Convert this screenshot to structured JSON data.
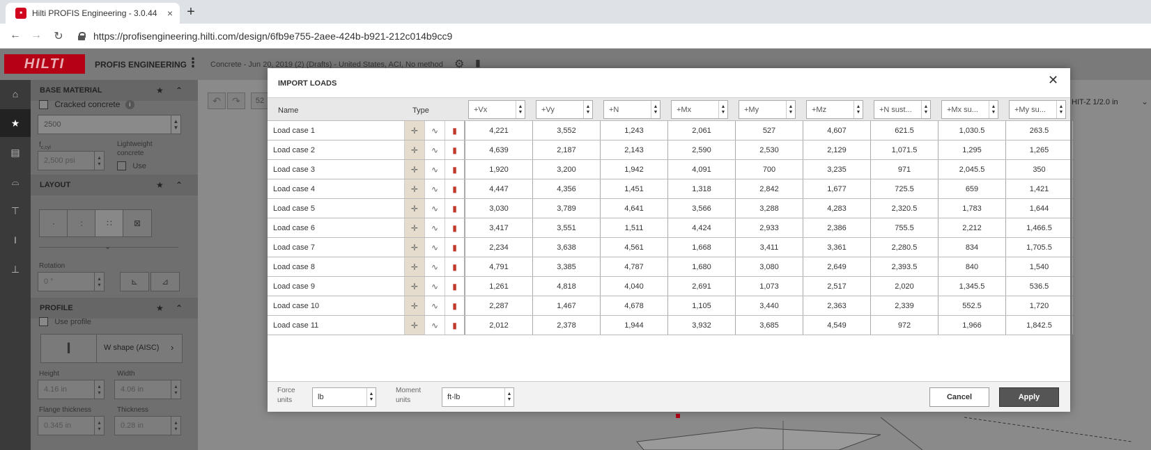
{
  "browser": {
    "tab_title": "Hilti PROFIS Engineering - 3.0.44",
    "tab_close": "×",
    "new_tab": "+",
    "url": "https://profisengineering.hilti.com/design/6fb9e755-2aee-424b-b921-212c014b9cc9"
  },
  "header": {
    "logo": "HILTI",
    "app_name": "PROFIS ENGINEERING",
    "project": "Concrete - Jun 20, 2019 (2) (Drafts) - United States, ACI, No method",
    "right_label": "HIT-Z 1/2.0 in"
  },
  "panel": {
    "base_material": {
      "title": "BASE MATERIAL",
      "cracked_label": "Cracked concrete",
      "strength_value": "2500",
      "fc_label": "f",
      "fc_sub": "c,cyl",
      "fc_value": "2,500 psi",
      "lightweight_label": "Lightweight concrete",
      "use_label": "Use"
    },
    "layout": {
      "title": "LAYOUT",
      "rotation_label": "Rotation",
      "rotation_value": "0 °"
    },
    "profile": {
      "title": "PROFILE",
      "use_profile_label": "Use profile",
      "profile_name": "W shape (AISC)",
      "height_label": "Height",
      "height_value": "4.16 in",
      "width_label": "Width",
      "width_value": "4.06 in",
      "flange_label": "Flange thickness",
      "flange_value": "0.345 in",
      "thickness_label": "Thickness",
      "thickness_value": "0.28 in"
    }
  },
  "canvas": {
    "zoom_partial": "52"
  },
  "modal": {
    "title": "IMPORT LOADS",
    "name_header": "Name",
    "type_header": "Type",
    "columns": [
      "+Vx",
      "+Vy",
      "+N",
      "+Mx",
      "+My",
      "+Mz",
      "+N sust...",
      "+Mx su...",
      "+My su..."
    ],
    "rows": [
      {
        "name": "Load case 1",
        "values": [
          "4,221",
          "3,552",
          "1,243",
          "2,061",
          "527",
          "4,607",
          "621.5",
          "1,030.5",
          "263.5"
        ]
      },
      {
        "name": "Load case 2",
        "values": [
          "4,639",
          "2,187",
          "2,143",
          "2,590",
          "2,530",
          "2,129",
          "1,071.5",
          "1,295",
          "1,265"
        ]
      },
      {
        "name": "Load case 3",
        "values": [
          "1,920",
          "3,200",
          "1,942",
          "4,091",
          "700",
          "3,235",
          "971",
          "2,045.5",
          "350"
        ]
      },
      {
        "name": "Load case 4",
        "values": [
          "4,447",
          "4,356",
          "1,451",
          "1,318",
          "2,842",
          "1,677",
          "725.5",
          "659",
          "1,421"
        ]
      },
      {
        "name": "Load case 5",
        "values": [
          "3,030",
          "3,789",
          "4,641",
          "3,566",
          "3,288",
          "4,283",
          "2,320.5",
          "1,783",
          "1,644"
        ]
      },
      {
        "name": "Load case 6",
        "values": [
          "3,417",
          "3,551",
          "1,511",
          "4,424",
          "2,933",
          "2,386",
          "755.5",
          "2,212",
          "1,466.5"
        ]
      },
      {
        "name": "Load case 7",
        "values": [
          "2,234",
          "3,638",
          "4,561",
          "1,668",
          "3,411",
          "3,361",
          "2,280.5",
          "834",
          "1,705.5"
        ]
      },
      {
        "name": "Load case 8",
        "values": [
          "4,791",
          "3,385",
          "4,787",
          "1,680",
          "3,080",
          "2,649",
          "2,393.5",
          "840",
          "1,540"
        ]
      },
      {
        "name": "Load case 9",
        "values": [
          "1,261",
          "4,818",
          "4,040",
          "2,691",
          "1,073",
          "2,517",
          "2,020",
          "1,345.5",
          "536.5"
        ]
      },
      {
        "name": "Load case 10",
        "values": [
          "2,287",
          "1,467",
          "4,678",
          "1,105",
          "3,440",
          "2,363",
          "2,339",
          "552.5",
          "1,720"
        ]
      },
      {
        "name": "Load case 11",
        "values": [
          "2,012",
          "2,378",
          "1,944",
          "3,932",
          "3,685",
          "4,549",
          "972",
          "1,966",
          "1,842.5"
        ]
      }
    ],
    "footer": {
      "force_units_label": "Force units",
      "force_units_value": "lb",
      "moment_units_label": "Moment units",
      "moment_units_value": "ft-lb",
      "cancel": "Cancel",
      "apply": "Apply"
    }
  },
  "colors": {
    "brand_red": "#d2051e",
    "type_selected_bg": "#e6dccd",
    "apply_bg": "#555555"
  }
}
